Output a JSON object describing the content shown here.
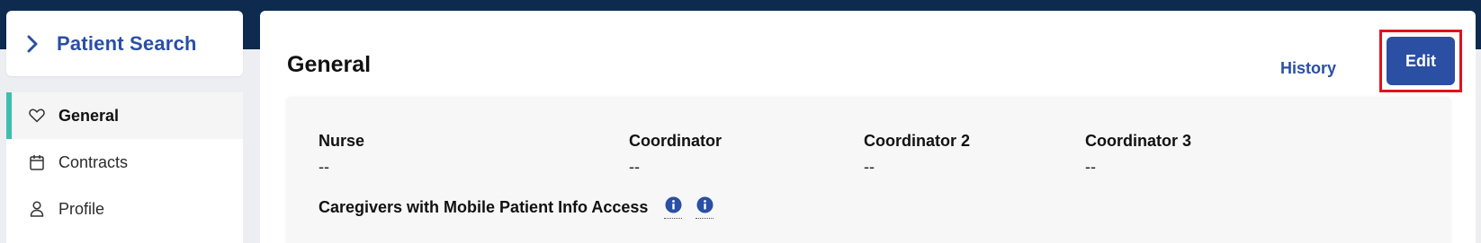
{
  "sidebar": {
    "search_title": "Patient Search",
    "items": [
      {
        "label": "General",
        "icon": "heart-icon",
        "active": true
      },
      {
        "label": "Contracts",
        "icon": "calendar-icon",
        "active": false
      },
      {
        "label": "Profile",
        "icon": "person-icon",
        "active": false
      }
    ]
  },
  "main": {
    "title": "General",
    "history_label": "History",
    "edit_label": "Edit",
    "fields": [
      {
        "label": "Nurse",
        "value": "--"
      },
      {
        "label": "Coordinator",
        "value": "--"
      },
      {
        "label": "Coordinator 2",
        "value": "--"
      },
      {
        "label": "Coordinator 3",
        "value": "--"
      }
    ],
    "access_label": "Caregivers with Mobile Patient Info Access"
  },
  "colors": {
    "top_band": "#0e2a4f",
    "accent_blue": "#2a4fa3",
    "active_indicator": "#3dbfb0",
    "highlight_red": "#e0121c"
  }
}
